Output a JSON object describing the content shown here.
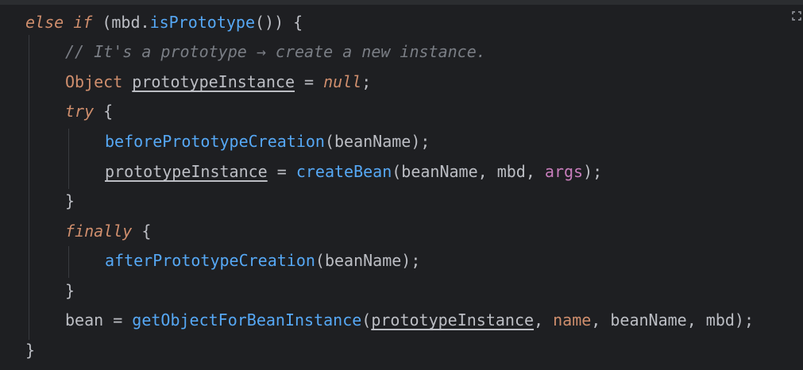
{
  "code": {
    "l1": {
      "else": "else",
      "if": "if",
      "open": " (mbd.",
      "method": "isPrototype",
      "close": "()) {"
    },
    "l2": {
      "comment": "// It's a prototype → create a new instance."
    },
    "l3": {
      "type": "Object",
      "var": "prototypeInstance",
      "eq": " = ",
      "null": "null",
      "semi": ";"
    },
    "l4": {
      "try": "try",
      "brace": " {"
    },
    "l5": {
      "method": "beforePrototypeCreation",
      "args": "(beanName);"
    },
    "l6": {
      "var": "prototypeInstance",
      "eq": " = ",
      "method": "createBean",
      "args_a": "(beanName, mbd, ",
      "args_param": "args",
      "args_b": ");"
    },
    "l7": {
      "brace": "}"
    },
    "l8": {
      "finally": "finally",
      "brace": " {"
    },
    "l9": {
      "method": "afterPrototypeCreation",
      "args": "(beanName);"
    },
    "l10": {
      "brace": "}"
    },
    "l11": {
      "var": "bean",
      "eq": " = ",
      "method": "getObjectForBeanInstance",
      "open": "(",
      "arg1": "prototypeInstance",
      "sep1": ", ",
      "arg2": "name",
      "rest": ", beanName, mbd);"
    },
    "l12": {
      "brace": "}"
    }
  },
  "colors": {
    "background": "#1e1f22",
    "keyword": "#cf8e6d",
    "function": "#56a8f5",
    "comment": "#7a7e85",
    "parameter": "#c77dbb",
    "text": "#bcbec4"
  },
  "icons": {
    "expand": "expand-icon"
  }
}
